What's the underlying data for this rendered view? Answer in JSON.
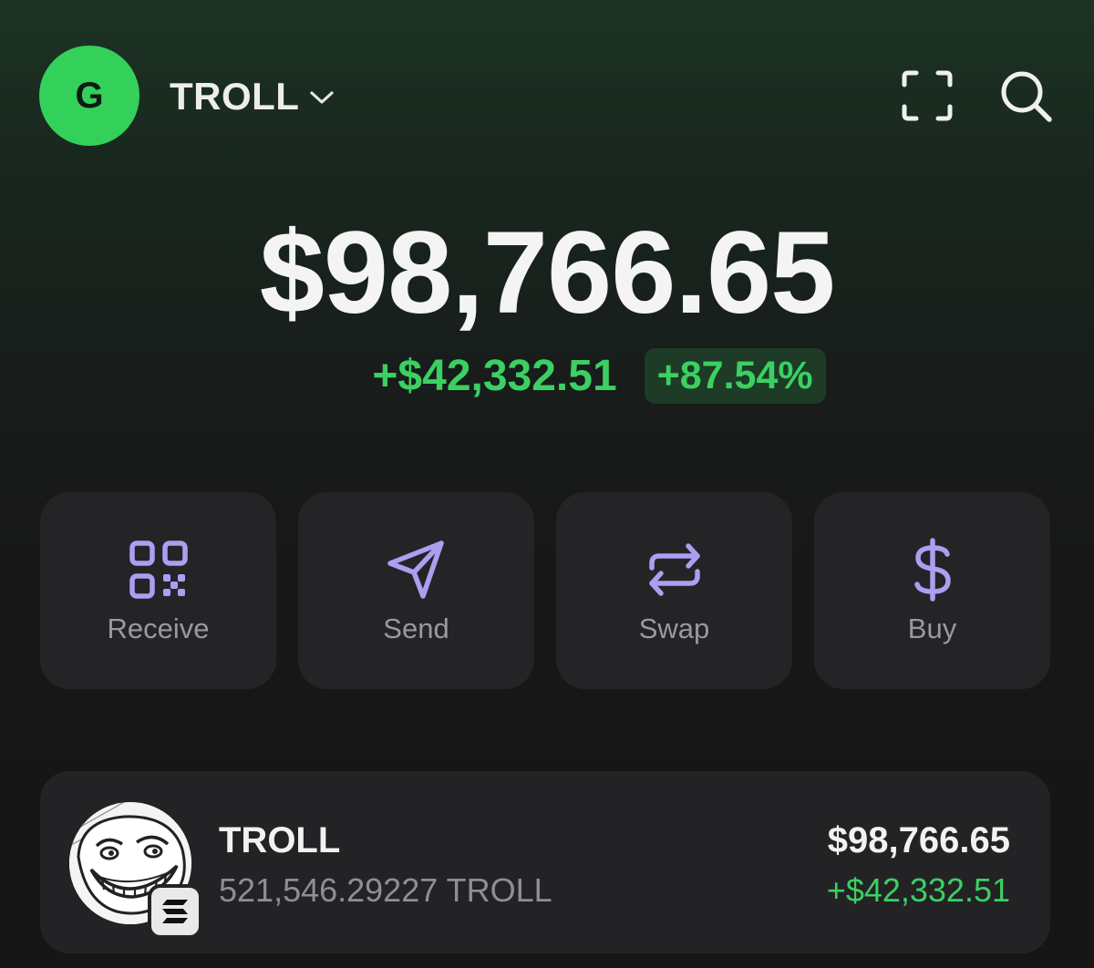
{
  "header": {
    "avatar_letter": "G",
    "account_name": "TROLL",
    "icons": {
      "dropdown": "chevron-down-icon",
      "scan": "scan-icon",
      "search": "search-icon"
    }
  },
  "portfolio": {
    "balance": "$98,766.65",
    "change_amount": "+$42,332.51",
    "change_percent": "+87.54%"
  },
  "actions": [
    {
      "label": "Receive",
      "icon": "qr-code-icon"
    },
    {
      "label": "Send",
      "icon": "send-arrow-icon"
    },
    {
      "label": "Swap",
      "icon": "swap-arrows-icon"
    },
    {
      "label": "Buy",
      "icon": "dollar-icon"
    }
  ],
  "tokens": [
    {
      "name": "TROLL",
      "amount": "521,546.29227 TROLL",
      "value": "$98,766.65",
      "change": "+$42,332.51",
      "logo": "troll-face-logo",
      "chain_badge": "solana-icon"
    }
  ],
  "colors": {
    "accent_green": "#3bd062",
    "avatar_green": "#33d15a",
    "icon_purple": "#ab9ff2",
    "card_bg": "#242427"
  }
}
